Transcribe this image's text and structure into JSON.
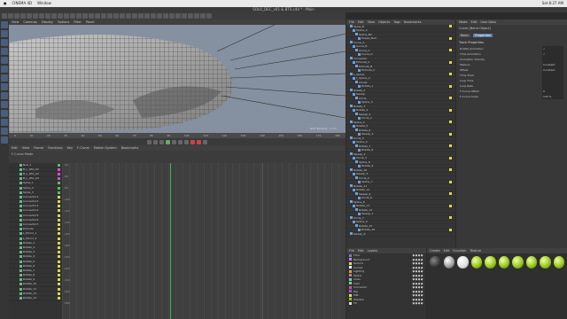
{
  "menubar": {
    "app": "CINEMA 4D",
    "menu": "Window",
    "status_time": "Sat 8:27 AM"
  },
  "window_title": "SOLO_DEC_v01 & BTS.c4d * - Main",
  "viewport": {
    "menu": [
      "View",
      "Cameras",
      "Display",
      "Options",
      "Filter",
      "Panel"
    ],
    "info": "Grid Spacing : 1 cm"
  },
  "timeline_ruler": [
    "0",
    "10",
    "20",
    "30",
    "40",
    "50",
    "60",
    "70",
    "80",
    "90",
    "100",
    "110",
    "120",
    "130",
    "140",
    "150",
    "160",
    "170",
    "180"
  ],
  "timeline_window": {
    "menu": [
      "Edit",
      "View",
      "Frame",
      "Functions",
      "Key",
      "F-Curve",
      "Motion System",
      "Bookmarks"
    ],
    "mode_label": "F-Curve Mode",
    "grid_values": [
      "-40",
      "-60",
      "-80",
      "-100",
      "-120",
      "-140",
      "-160",
      "-180",
      "-200",
      "-220",
      "-240",
      "-260",
      "-280"
    ]
  },
  "tracks": [
    {
      "name": "Null_1",
      "color": "#5cbf5c"
    },
    {
      "name": "B_L_LEG_01",
      "color": "#d84fd8"
    },
    {
      "name": "B_L_LEG_02",
      "color": "#d84fd8"
    },
    {
      "name": "B_L_LEG_03",
      "color": "#d84fd8"
    },
    {
      "name": "Spine_1",
      "color": "#5cbf5c"
    },
    {
      "name": "Spine_2",
      "color": "#5cbf5c"
    },
    {
      "name": "Spine_3",
      "color": "#5cbf5c"
    },
    {
      "name": "Connector1",
      "color": "#d8d84f"
    },
    {
      "name": "Connector2",
      "color": "#d8d84f"
    },
    {
      "name": "Connector3",
      "color": "#d8d84f"
    },
    {
      "name": "Connector4",
      "color": "#d8d84f"
    },
    {
      "name": "Connector5",
      "color": "#d8d84f"
    },
    {
      "name": "Connector6",
      "color": "#d8d84f"
    },
    {
      "name": "Connector7",
      "color": "#d8d84f"
    },
    {
      "name": "Extrude",
      "color": "#d8d84f"
    },
    {
      "name": "L_Mirror_1",
      "color": "#d8d84f"
    },
    {
      "name": "L_Mirror_2",
      "color": "#d8d84f"
    },
    {
      "name": "Rotate_1",
      "color": "#d8d84f"
    },
    {
      "name": "Rotate_2",
      "color": "#d8d84f"
    },
    {
      "name": "Rotate_3",
      "color": "#d8d84f"
    },
    {
      "name": "Rotate_4",
      "color": "#d8d84f"
    },
    {
      "name": "Rotate_5",
      "color": "#d8d84f"
    },
    {
      "name": "Rotate_6",
      "color": "#d8d84f"
    },
    {
      "name": "Rotate_7",
      "color": "#d8d84f"
    },
    {
      "name": "Rotate_8",
      "color": "#d8d84f"
    },
    {
      "name": "Rotate_9",
      "color": "#d8d84f"
    },
    {
      "name": "Rotate_10",
      "color": "#d8d84f"
    },
    {
      "name": "Rotate_11",
      "color": "#d8d84f"
    },
    {
      "name": "Rotate_12",
      "color": "#d8d84f"
    },
    {
      "name": "Rotate_13",
      "color": "#d8d84f"
    }
  ],
  "object_manager": {
    "menu": [
      "File",
      "Edit",
      "View",
      "Objects",
      "Tags",
      "Bookmarks"
    ],
    "objects": [
      "Spine_B",
      "Spline_C",
      "Spline_B2",
      "Shape_Null",
      "Curve_A",
      "Curve_B",
      "Curve_C",
      "Curve_D",
      "Connector",
      "Extrude_A",
      "Extrude_B",
      "Extrude_C",
      "L_Spline",
      "L_Spline_2",
      "Cloner",
      "Rotate_1",
      "Rotate_2",
      "Sweep",
      "Circle",
      "Spline_3",
      "Rotate_3",
      "Rotate_4",
      "Sweep_2",
      "Circle_2",
      "Spline_4",
      "Rotate_5",
      "Rotate_6",
      "Sweep_3",
      "Circle_3",
      "Spline_5",
      "Rotate_7",
      "Rotate_8",
      "Sweep_4",
      "Circle_4",
      "Spline_6",
      "Rotate_9",
      "Rotate_10",
      "Sweep_5",
      "Circle_5",
      "Spline_7",
      "Rotate_11",
      "Rotate_12",
      "Sweep_6",
      "Circle_6",
      "Spline_8",
      "Rotate_13",
      "Rotate_14",
      "Sweep_7",
      "Circle_7",
      "Spline_9",
      "Rotate_15",
      "Rotate_16",
      "Sweep_8"
    ]
  },
  "attributes": {
    "header": [
      "Mode",
      "Edit",
      "User Data"
    ],
    "object_title": "Curve [Bend Object]",
    "tabs": [
      "Basic",
      "Properties"
    ],
    "active_tab": "Properties",
    "section": "Track Properties",
    "rows": [
      {
        "label": "Enable Animation",
        "value": "✓"
      },
      {
        "label": "Time Animation",
        "value": "✓"
      },
      {
        "label": "Animation Velocity",
        "value": ""
      },
      {
        "label": "Mixture",
        "value": "Constant"
      },
      {
        "label": "Offset",
        "value": "Constant"
      },
      {
        "label": "Time Track",
        "value": ""
      },
      {
        "label": "Loop Time",
        "value": ""
      },
      {
        "label": "Loop Rate",
        "value": ""
      },
      {
        "label": "F-Curve Offset",
        "value": "0"
      },
      {
        "label": "F-Curve Scale",
        "value": "100 %"
      }
    ]
  },
  "layers": {
    "header": [
      "File",
      "Edit",
      "Layers"
    ],
    "items": [
      {
        "name": "Floor",
        "color": "#7a7ad8"
      },
      {
        "name": "Background",
        "color": "#d87ad8"
      },
      {
        "name": "Ground",
        "color": "#d8d87a"
      },
      {
        "name": "Curves",
        "color": "#ffffff"
      },
      {
        "name": "Lighting",
        "color": "#d8a050"
      },
      {
        "name": "Spline",
        "color": "#d87a7a"
      },
      {
        "name": "Lines",
        "color": "#50d8d8"
      },
      {
        "name": "Cam",
        "color": "#7ad87a"
      },
      {
        "name": "Connector",
        "color": "#d850a0"
      },
      {
        "name": "Rig",
        "color": "#a050d8"
      },
      {
        "name": "Mat",
        "color": "#e0e050"
      },
      {
        "name": "Shadow",
        "color": "#8fc41a"
      },
      {
        "name": "FX",
        "color": "#d8d8d8"
      }
    ]
  },
  "materials": {
    "header": [
      "Create",
      "Edit",
      "Function",
      "Texture"
    ],
    "swatches": [
      "dark",
      "gray",
      "white",
      "green",
      "green",
      "green",
      "green",
      "green",
      "green",
      "green"
    ]
  }
}
